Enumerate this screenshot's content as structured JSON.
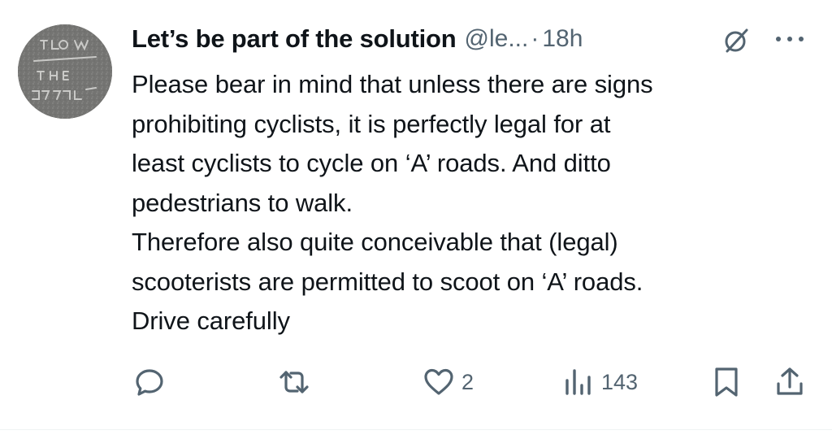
{
  "tweet": {
    "display_name": "Let’s be part of the solution",
    "handle": "@le...",
    "separator": "·",
    "time": "18h",
    "avatar_icon": "chalk-road-marking-avatar",
    "body_lines": [
      "Please bear in mind that unless there are signs",
      "prohibiting cyclists, it is perfectly legal for at",
      "least cyclists to cycle on ‘A’ roads. And ditto",
      "pedestrians to walk.",
      "Therefore also quite conceivable that (legal)",
      "scooterists are permitted to scoot on ‘A’ roads.",
      "Drive carefully"
    ]
  },
  "actions": {
    "reply_count": "",
    "retweet_count": "",
    "like_count": "2",
    "views_count": "143"
  },
  "colors": {
    "text_primary": "#0f1419",
    "text_secondary": "#536471",
    "divider": "#eff3f4"
  }
}
